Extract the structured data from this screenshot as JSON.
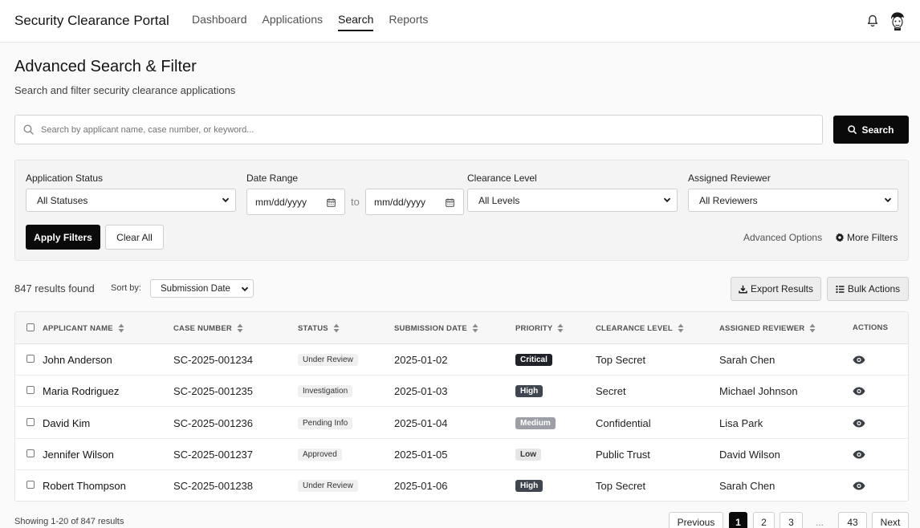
{
  "app": {
    "title": "Security Clearance Portal"
  },
  "nav": {
    "items": [
      {
        "label": "Dashboard",
        "active": false
      },
      {
        "label": "Applications",
        "active": false
      },
      {
        "label": "Search",
        "active": true
      },
      {
        "label": "Reports",
        "active": false
      }
    ]
  },
  "header": {
    "notifications_icon": "bell-icon",
    "avatar_icon": "user-avatar"
  },
  "page": {
    "title": "Advanced Search & Filter",
    "subtitle": "Search and filter security clearance applications"
  },
  "search": {
    "placeholder": "Search by applicant name, case number, or keyword...",
    "value": "",
    "button_label": "Search"
  },
  "filters": {
    "status": {
      "label": "Application Status",
      "value": "All Statuses"
    },
    "date_range": {
      "label": "Date Range",
      "from_placeholder": "mm/dd/yyyy",
      "to_placeholder": "mm/dd/yyyy",
      "separator": "to"
    },
    "clearance": {
      "label": "Clearance Level",
      "value": "All Levels"
    },
    "reviewer": {
      "label": "Assigned Reviewer",
      "value": "All Reviewers"
    },
    "apply_label": "Apply Filters",
    "clear_label": "Clear All",
    "advanced_label": "Advanced Options",
    "more_label": "More Filters"
  },
  "results": {
    "count_text": "847 results found",
    "sort_label": "Sort by:",
    "sort_value": "Submission Date",
    "export_label": "Export Results",
    "bulk_label": "Bulk Actions"
  },
  "table": {
    "columns": [
      "APPLICANT NAME",
      "CASE NUMBER",
      "STATUS",
      "SUBMISSION DATE",
      "PRIORITY",
      "CLEARANCE LEVEL",
      "ASSIGNED REVIEWER",
      "ACTIONS"
    ],
    "rows": [
      {
        "name": "John Anderson",
        "case": "SC-2025-001234",
        "status": "Under Review",
        "date": "2025-01-02",
        "priority": "Critical",
        "priority_color": "#1f2329",
        "clearance": "Top Secret",
        "reviewer": "Sarah Chen"
      },
      {
        "name": "Maria Rodriguez",
        "case": "SC-2025-001235",
        "status": "Investigation",
        "date": "2025-01-03",
        "priority": "High",
        "priority_color": "#3f4650",
        "clearance": "Secret",
        "reviewer": "Michael Johnson"
      },
      {
        "name": "David Kim",
        "case": "SC-2025-001236",
        "status": "Pending Info",
        "date": "2025-01-04",
        "priority": "Medium",
        "priority_color": "#9ca0a6",
        "clearance": "Confidential",
        "reviewer": "Lisa Park"
      },
      {
        "name": "Jennifer Wilson",
        "case": "SC-2025-001237",
        "status": "Approved",
        "date": "2025-01-05",
        "priority": "Low",
        "priority_color": "#e6e6e6",
        "priority_text_color": "#333333",
        "clearance": "Public Trust",
        "reviewer": "David Wilson"
      },
      {
        "name": "Robert Thompson",
        "case": "SC-2025-001238",
        "status": "Under Review",
        "date": "2025-01-06",
        "priority": "High",
        "priority_color": "#3f4650",
        "clearance": "Top Secret",
        "reviewer": "Sarah Chen"
      }
    ]
  },
  "pagination": {
    "showing_text": "Showing 1-20 of 847 results",
    "previous_label": "Previous",
    "pages": [
      "1",
      "2",
      "3"
    ],
    "ellipsis": "...",
    "last_page": "43",
    "next_label": "Next",
    "current": "1"
  }
}
